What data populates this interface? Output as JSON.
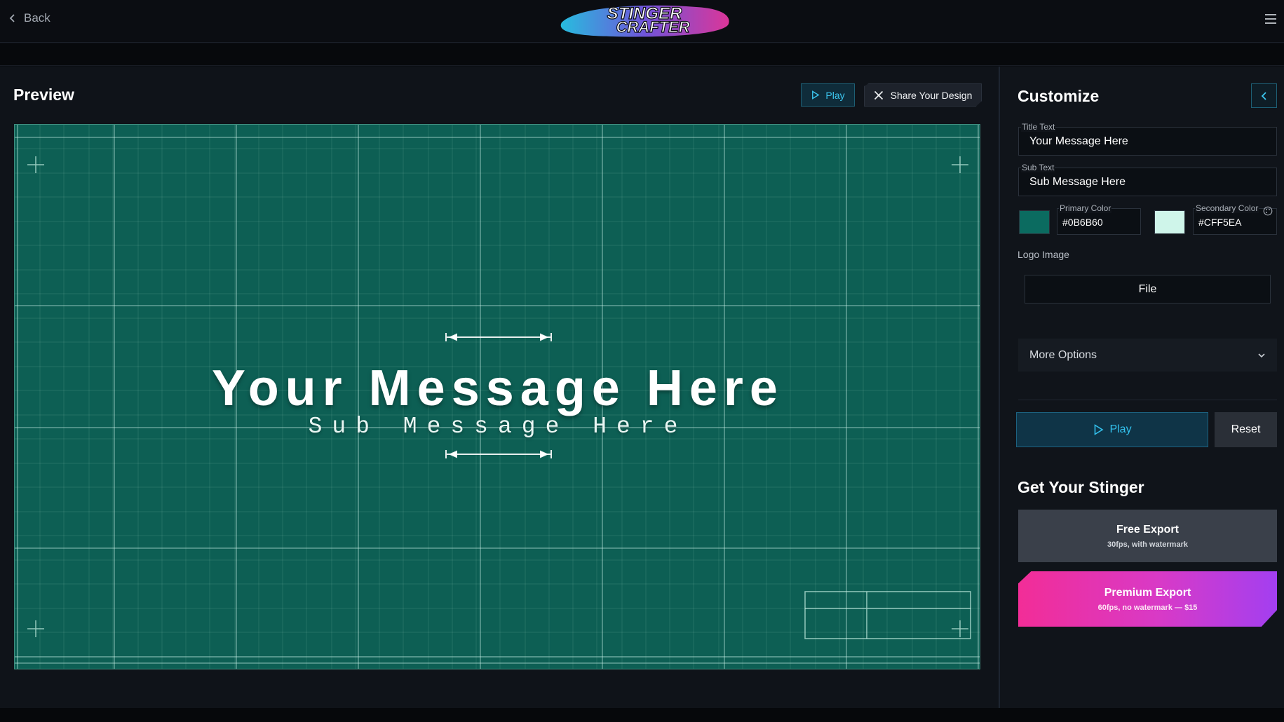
{
  "topbar": {
    "back_label": "Back",
    "logo_line1": "STINGER",
    "logo_line2": "CRAFTER"
  },
  "preview": {
    "title": "Preview",
    "play_label": "Play",
    "share_label": "Share Your Design",
    "headline": "Your Message Here",
    "subline": "Sub Message Here",
    "canvas_color": "#0B6B60",
    "grid_color": "#CFF5EA"
  },
  "sidebar": {
    "title": "Customize",
    "title_text": {
      "label": "Title Text",
      "value": "Your Message Here"
    },
    "sub_text": {
      "label": "Sub Text",
      "value": "Sub Message Here"
    },
    "primary_color": {
      "label": "Primary Color",
      "value": "#0B6B60",
      "swatch": "#0B6B60"
    },
    "secondary_color": {
      "label": "Secondary Color",
      "value": "#CFF5EA",
      "swatch": "#CFF5EA"
    },
    "logo_label": "Logo Image",
    "file_label": "File",
    "more_options_label": "More Options",
    "play_label": "Play",
    "reset_label": "Reset"
  },
  "export": {
    "title": "Get Your Stinger",
    "free": {
      "label": "Free Export",
      "detail": "30fps, with watermark"
    },
    "premium": {
      "label": "Premium Export",
      "detail": "60fps, no watermark — $15"
    }
  },
  "colors": {
    "accent": "#33C2EE",
    "premium_start": "#F22D97",
    "premium_end": "#A33FF0"
  }
}
